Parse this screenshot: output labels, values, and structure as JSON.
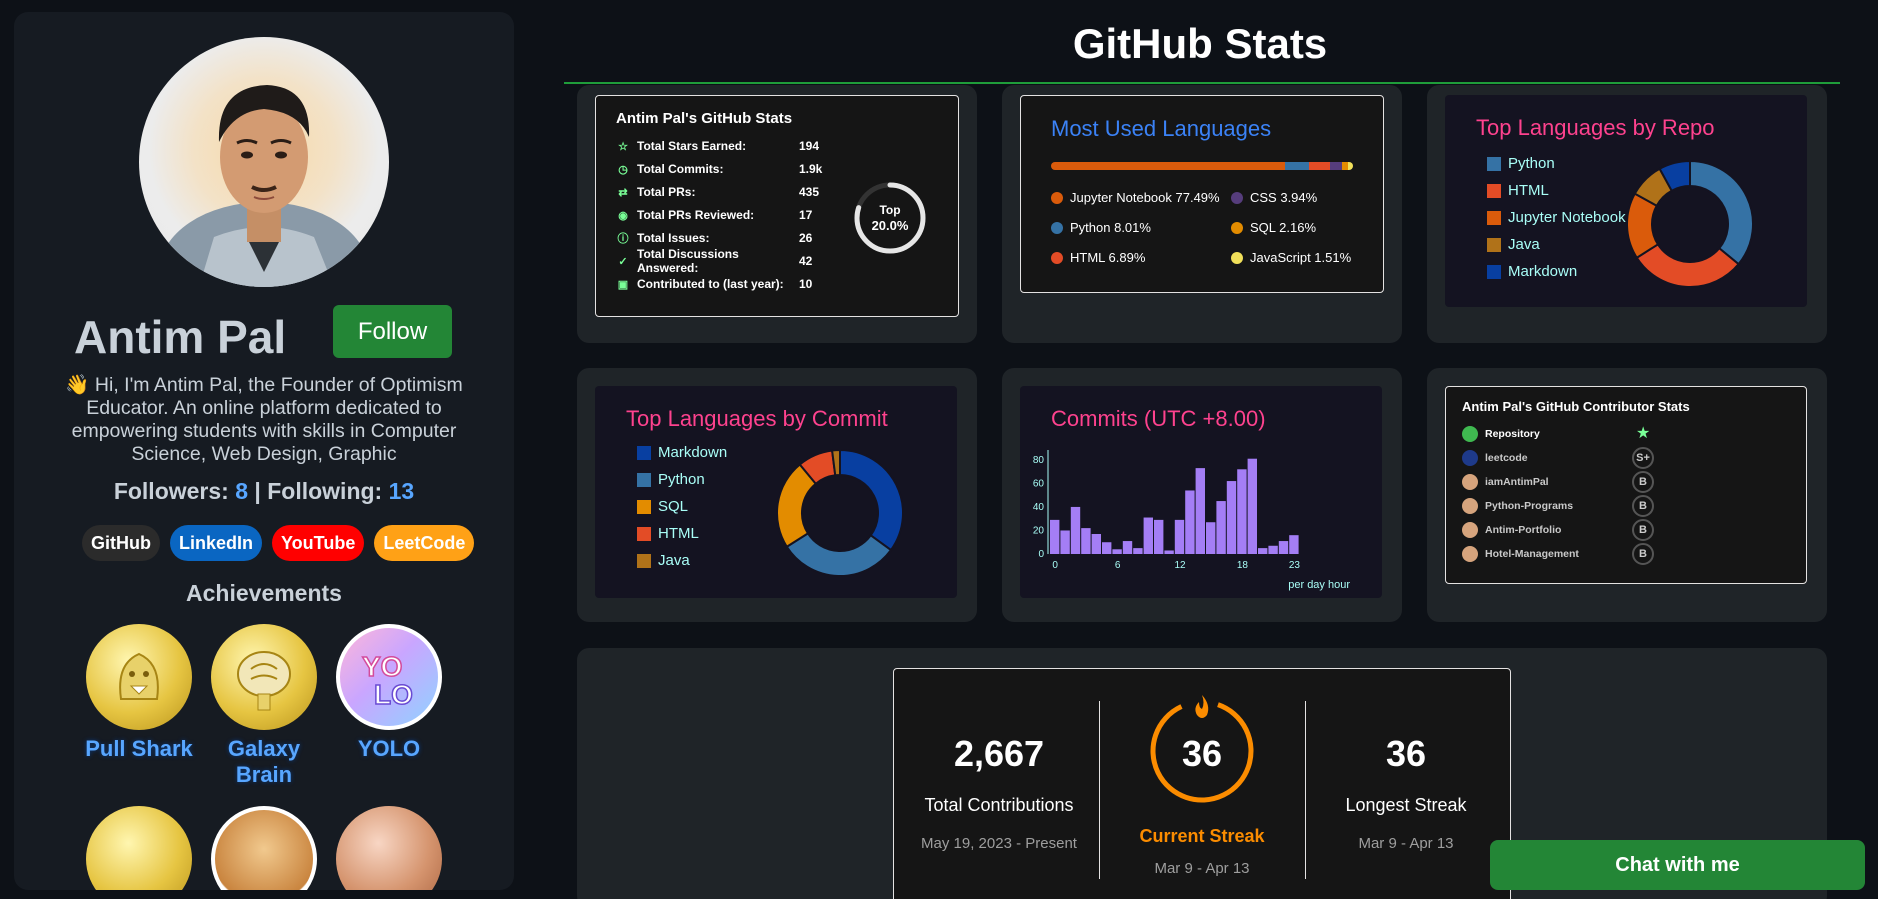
{
  "profile": {
    "name": "Antim Pal",
    "follow_label": "Follow",
    "bio": "👋 Hi, I'm Antim Pal, the Founder of Optimism Educator. An online platform dedicated to empowering students with skills in Computer Science, Web Design, Graphic",
    "followers_label": "Followers:",
    "followers": "8",
    "separator": "|",
    "following_label": "Following:",
    "following": "13",
    "links": [
      {
        "label": "GitHub",
        "color": "#2b2b2b"
      },
      {
        "label": "LinkedIn",
        "color": "#0a66c2"
      },
      {
        "label": "YouTube",
        "color": "#ff0000"
      },
      {
        "label": "LeetCode",
        "color": "#ffa116"
      }
    ],
    "achievements_title": "Achievements",
    "achievements": [
      {
        "label": "Pull Shark"
      },
      {
        "label": "Galaxy Brain"
      },
      {
        "label": "YOLO"
      }
    ]
  },
  "page_title": "GitHub Stats",
  "github_stats": {
    "title": "Antim Pal's GitHub Stats",
    "rows": [
      {
        "label": "Total Stars Earned:",
        "value": "194"
      },
      {
        "label": "Total Commits:",
        "value": "1.9k"
      },
      {
        "label": "Total PRs:",
        "value": "435"
      },
      {
        "label": "Total PRs Reviewed:",
        "value": "17"
      },
      {
        "label": "Total Issues:",
        "value": "26"
      },
      {
        "label": "Total Discussions Answered:",
        "value": "42"
      },
      {
        "label": "Contributed to (last year):",
        "value": "10"
      }
    ],
    "rank_top": "Top",
    "rank_pct": "20.0%",
    "rank_fraction": 0.8
  },
  "most_used": {
    "title": "Most Used Languages",
    "langs": [
      {
        "label": "Jupyter Notebook 77.49%",
        "pct": 77.49,
        "color": "#da5b0b"
      },
      {
        "label": "Python 8.01%",
        "pct": 8.01,
        "color": "#3572a5"
      },
      {
        "label": "HTML 6.89%",
        "pct": 6.89,
        "color": "#e34c26"
      },
      {
        "label": "CSS 3.94%",
        "pct": 3.94,
        "color": "#563d7c"
      },
      {
        "label": "SQL 2.16%",
        "pct": 2.16,
        "color": "#e38c00"
      },
      {
        "label": "JavaScript 1.51%",
        "pct": 1.51,
        "color": "#f1e05a"
      }
    ]
  },
  "top_by_repo": {
    "title": "Top Languages by Repo",
    "items": [
      {
        "label": "Python",
        "color": "#3572a5",
        "value": 36
      },
      {
        "label": "HTML",
        "color": "#e34c26",
        "value": 30
      },
      {
        "label": "Jupyter Notebook",
        "color": "#da5b0b",
        "value": 17
      },
      {
        "label": "Java",
        "color": "#b07219",
        "value": 9
      },
      {
        "label": "Markdown",
        "color": "#083fa1",
        "value": 8
      }
    ]
  },
  "top_by_commit": {
    "title": "Top Languages by Commit",
    "items": [
      {
        "label": "Markdown",
        "color": "#083fa1",
        "value": 35
      },
      {
        "label": "Python",
        "color": "#3572a5",
        "value": 31
      },
      {
        "label": "SQL",
        "color": "#e38c00",
        "value": 23
      },
      {
        "label": "HTML",
        "color": "#e34c26",
        "value": 9
      },
      {
        "label": "Java",
        "color": "#b07219",
        "value": 2
      }
    ]
  },
  "commits_chart": {
    "title": "Commits (UTC +8.00)",
    "xlabel": "per day hour"
  },
  "chart_data": {
    "type": "bar",
    "title": "Commits (UTC +8.00)",
    "xlabel": "per day hour",
    "ylabel": "",
    "x": [
      0,
      1,
      2,
      3,
      4,
      5,
      6,
      7,
      8,
      9,
      10,
      11,
      12,
      13,
      14,
      15,
      16,
      17,
      18,
      19,
      20,
      21,
      22,
      23
    ],
    "values": [
      29,
      20,
      40,
      22,
      17,
      10,
      4,
      11,
      5,
      31,
      29,
      3,
      29,
      54,
      73,
      27,
      45,
      62,
      72,
      81,
      5,
      7,
      11,
      16
    ],
    "xticks": [
      0,
      6,
      12,
      18,
      23
    ],
    "yticks": [
      0,
      20,
      40,
      60,
      80
    ],
    "ylim": [
      0,
      85
    ],
    "color": "#a47ef5"
  },
  "contributor_stats": {
    "title": "Antim Pal's GitHub Contributor Stats",
    "header_label": "Repository",
    "header_rank": "★",
    "rows": [
      {
        "name": "leetcode",
        "rank": "S+"
      },
      {
        "name": "iamAntimPal",
        "rank": "B"
      },
      {
        "name": "Python-Programs",
        "rank": "B"
      },
      {
        "name": "Antim-Portfolio",
        "rank": "B"
      },
      {
        "name": "Hotel-Management",
        "rank": "B"
      }
    ]
  },
  "streak": {
    "total": "2,667",
    "total_label": "Total Contributions",
    "total_range": "May 19, 2023 - Present",
    "current": "36",
    "current_label": "Current Streak",
    "current_range": "Mar 9 - Apr 13",
    "longest": "36",
    "longest_label": "Longest Streak",
    "longest_range": "Mar 9 - Apr 13",
    "accent": "#fb8c00"
  },
  "chat_label": "Chat with me"
}
